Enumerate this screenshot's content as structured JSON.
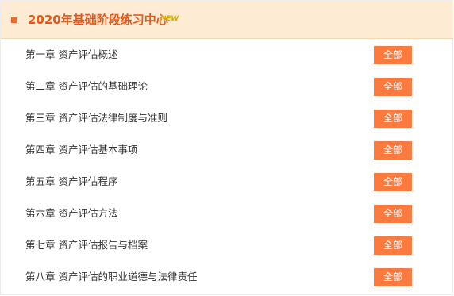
{
  "header": {
    "title": "2020年基础阶段练习中心",
    "badge": "NEW"
  },
  "chapters": [
    {
      "label": "第一章  资产评估概述",
      "button": "全部"
    },
    {
      "label": "第二章  资产评估的基础理论",
      "button": "全部"
    },
    {
      "label": "第三章  资产评估法律制度与准则",
      "button": "全部"
    },
    {
      "label": "第四章  资产评估基本事项",
      "button": "全部"
    },
    {
      "label": "第五章  资产评估程序",
      "button": "全部"
    },
    {
      "label": "第六章  资产评估方法",
      "button": "全部"
    },
    {
      "label": "第七章  资产评估报告与档案",
      "button": "全部"
    },
    {
      "label": "第八章  资产评估的职业道德与法律责任",
      "button": "全部"
    }
  ],
  "colors": {
    "accent": "#e8561b",
    "button": "#fb7a3f",
    "header_bg": "#fdecd3",
    "badge": "#d6ad00"
  }
}
